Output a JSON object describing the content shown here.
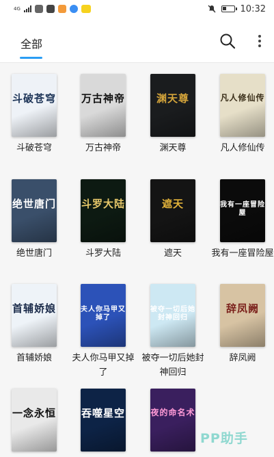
{
  "status_bar": {
    "network": "4G",
    "time": "10:32",
    "icons": [
      "message-icon",
      "email-icon",
      "app-icon",
      "app-icon",
      "app-icon"
    ]
  },
  "header": {
    "tab_label": "全部",
    "accent_color": "#2a9df4",
    "search_icon": "search-icon",
    "more_icon": "more-vertical-icon"
  },
  "books": [
    {
      "name": "斗破苍穹",
      "cover_text": "斗破苍穹",
      "bg": "#eef2f7",
      "fg": "#1e3558"
    },
    {
      "name": "万古神帝",
      "cover_text": "万古神帝",
      "bg": "#d9d9d9",
      "fg": "#111111"
    },
    {
      "name": "渊天尊",
      "cover_text": "渊天尊",
      "bg": "#1a1c1e",
      "fg": "#d4a43a"
    },
    {
      "name": "凡人修仙传",
      "cover_text": "凡人修仙传",
      "bg": "#e6dfc8",
      "fg": "#3b2f1a"
    },
    {
      "name": "绝世唐门",
      "cover_text": "绝世唐门",
      "bg": "#3a4f6a",
      "fg": "#ffffff"
    },
    {
      "name": "斗罗大陆",
      "cover_text": "斗罗大陆",
      "bg": "#0d1a12",
      "fg": "#e7c86a"
    },
    {
      "name": "遮天",
      "cover_text": "遮天",
      "bg": "#141414",
      "fg": "#e2b23a"
    },
    {
      "name": "我有一座冒险屋",
      "cover_text": "我有一座冒险屋",
      "bg": "#0b0b0b",
      "fg": "#ffffff"
    },
    {
      "name": "首辅娇娘",
      "cover_text": "首辅娇娘",
      "bg": "#eef3f8",
      "fg": "#1b2b4a"
    },
    {
      "name": "夫人你马甲又掉了",
      "cover_text": "夫人你马甲又掉了",
      "bg": "#2c52b8",
      "fg": "#ffffff"
    },
    {
      "name": "被夺一切后她封神回归",
      "cover_text": "被夺一切后她封神回归",
      "bg": "#cde8f3",
      "fg": "#ffffff"
    },
    {
      "name": "辞凤阙",
      "cover_text": "辞凤阙",
      "bg": "#d7c3a3",
      "fg": "#7a1f1a"
    },
    {
      "name": "",
      "cover_text": "一念永恒",
      "bg": "#e9e9e9",
      "fg": "#111111"
    },
    {
      "name": "",
      "cover_text": "吞噬星空",
      "bg": "#0d2346",
      "fg": "#ffffff"
    },
    {
      "name": "",
      "cover_text": "夜的命名术",
      "bg": "#3a1f5e",
      "fg": "#ff9ad6"
    }
  ],
  "watermark": "PP助手"
}
